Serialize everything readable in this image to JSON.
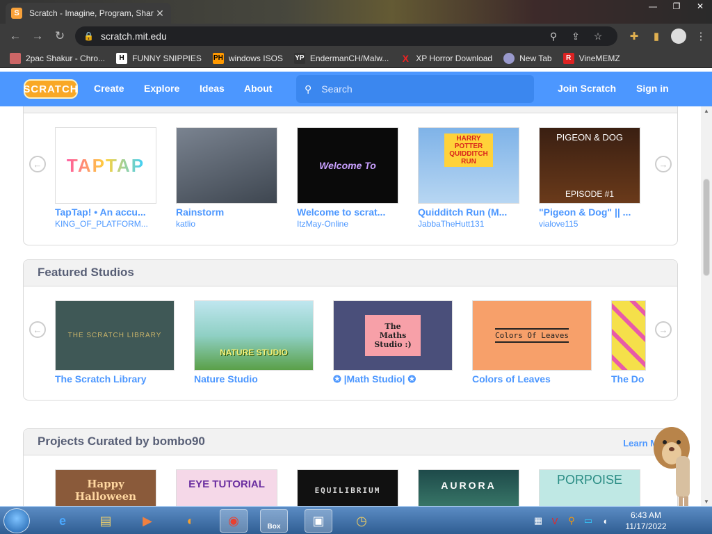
{
  "browser": {
    "tab_title": "Scratch - Imagine, Program, Shar",
    "favicon": "S",
    "url": "scratch.mit.edu",
    "bookmarks": [
      {
        "label": "2pac Shakur - Chro...",
        "icon_color": "#c66"
      },
      {
        "label": "FUNNY SNIPPIES",
        "icon_color": "#fff",
        "icon_text": "H"
      },
      {
        "label": "windows ISOS",
        "icon_color": "#f90",
        "icon_text": "PH"
      },
      {
        "label": "EndermanCH/Malw...",
        "icon_color": "#333",
        "icon_text": "YP"
      },
      {
        "label": "XP Horror Download",
        "icon_color": "#e22",
        "icon_text": "X"
      },
      {
        "label": "New Tab",
        "icon_color": "#99c"
      },
      {
        "label": "VineMEMZ",
        "icon_color": "#d22",
        "icon_text": "R"
      }
    ]
  },
  "nav": {
    "logo": "SCRATCH",
    "create": "Create",
    "explore": "Explore",
    "ideas": "Ideas",
    "about": "About",
    "search_placeholder": "Search",
    "join": "Join Scratch",
    "signin": "Sign in"
  },
  "projects_row": [
    {
      "title": "TapTap! • An accu...",
      "author": "KING_OF_PLATFORM...",
      "thumb_text": "TAPTAP",
      "thumb_bg": "#ffffff",
      "thumb_fg": "#e84393"
    },
    {
      "title": "Rainstorm",
      "author": "katlio",
      "thumb_text": "",
      "thumb_bg": "#5a6370",
      "thumb_fg": "#ffffff"
    },
    {
      "title": "Welcome to scrat...",
      "author": "ItzMay-Online",
      "thumb_text": "Welcome To",
      "thumb_bg": "#0a0a0a",
      "thumb_fg": "#c9a0ff"
    },
    {
      "title": "Quidditch Run (M...",
      "author": "JabbaTheHutt131",
      "thumb_text": "HARRY POTTER QUIDDITCH RUN",
      "thumb_bg": "#7fb3e8",
      "thumb_fg": "#ffd23a"
    },
    {
      "title": "\"Pigeon & Dog\" || ...",
      "author": "vialove115",
      "thumb_text": "PIGEON & DOG",
      "thumb_text2": "EPISODE #1",
      "thumb_bg": "#3a1f12",
      "thumb_fg": "#ffffff"
    }
  ],
  "featured_studios": {
    "heading": "Featured Studios",
    "items": [
      {
        "title": "The Scratch Library",
        "thumb_text": "THE SCRATCH LIBRARY",
        "thumb_bg": "#3f5856",
        "thumb_fg": "#c8b36a"
      },
      {
        "title": "Nature Studio",
        "thumb_text": "NATURE STUDIO",
        "thumb_bg": "#8fd0c4",
        "thumb_fg": "#2d5a10"
      },
      {
        "title": "✪ |Math Studio| ✪",
        "thumb_text": "The Maths Studio :)",
        "thumb_bg": "#4a4f7a",
        "thumb_fg": "#222222"
      },
      {
        "title": "Colors of Leaves",
        "thumb_text": "Colors Of Leaves",
        "thumb_bg": "#f7a06a",
        "thumb_fg": "#222222"
      },
      {
        "title": "The Do",
        "thumb_text": "",
        "thumb_bg": "#f5e04a",
        "thumb_fg": "#ffffff"
      }
    ]
  },
  "curated": {
    "heading": "Projects Curated by bombo90",
    "learn_more": "Learn Mo",
    "items": [
      {
        "thumb_text": "Happy Halloween",
        "thumb_bg": "#8a5a3a",
        "thumb_fg": "#ffd7a0"
      },
      {
        "thumb_text": "EYE TUTORIAL",
        "thumb_bg": "#f5d8e8",
        "thumb_fg": "#6b2fa0"
      },
      {
        "thumb_text": "EQUILIBRIUM",
        "thumb_bg": "#111111",
        "thumb_fg": "#dddddd"
      },
      {
        "thumb_text": "AURORA",
        "thumb_bg": "#1e4a4a",
        "thumb_fg": "#ffffff"
      },
      {
        "thumb_text": "PORPOISE",
        "thumb_bg": "#bfe8e4",
        "thumb_fg": "#2a8c84"
      }
    ]
  },
  "taskbar": {
    "time": "6:43 AM",
    "date": "11/17/2022",
    "box_label": "Box"
  }
}
